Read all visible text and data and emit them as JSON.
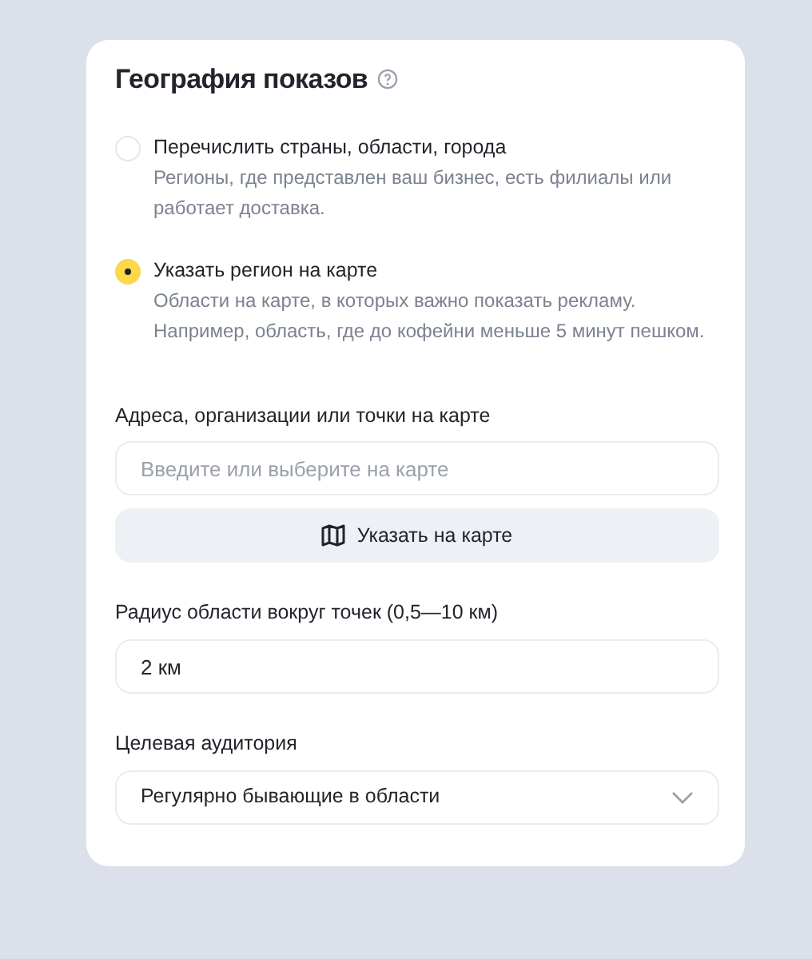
{
  "title": "География показов",
  "options": [
    {
      "label": "Перечислить страны, области, города",
      "description": "Регионы, где представлен ваш бизнес, есть филиалы или работает доставка.",
      "selected": false
    },
    {
      "label": "Указать регион на карте",
      "description": "Области на карте, в которых важно показать рекламу. Например, область, где до кофейни меньше 5 минут пешком.",
      "selected": true
    }
  ],
  "fields": [
    {
      "kind": "input",
      "label": "Адреса, организации или точки на карте",
      "placeholder": "Введите или выберите на карте",
      "button": "Указать на карте"
    },
    {
      "kind": "input",
      "label": "Радиус области вокруг точек (0,5—10 км)",
      "value": "2 км"
    },
    {
      "kind": "select",
      "label": "Целевая аудитория",
      "value": "Регулярно бывающие в области"
    }
  ]
}
